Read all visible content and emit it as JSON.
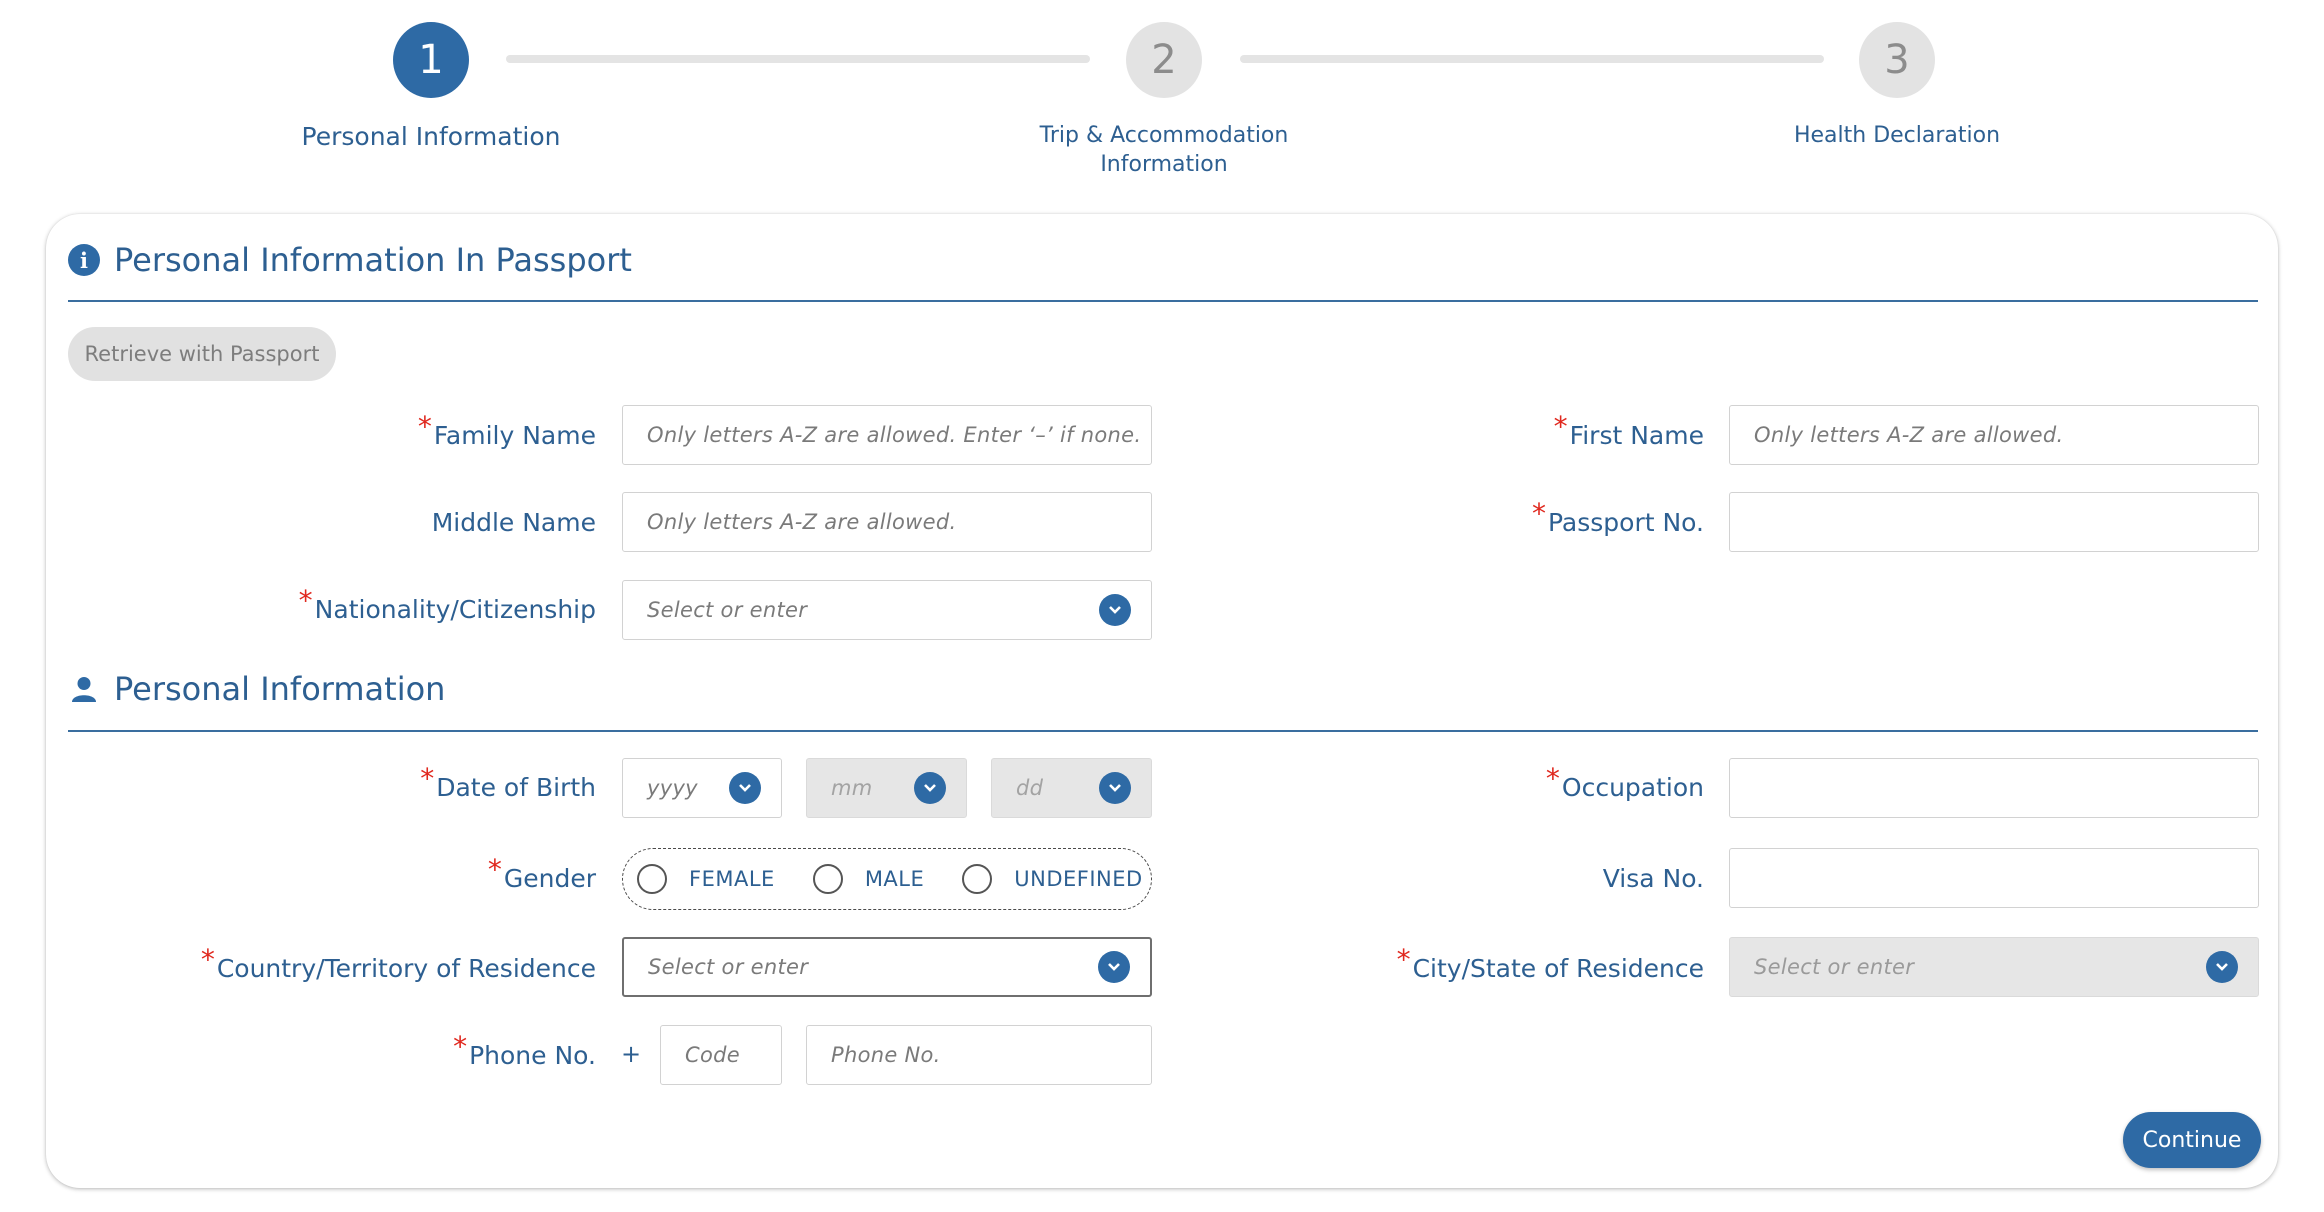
{
  "stepper": {
    "steps": [
      {
        "number": "1",
        "label": "Personal Information",
        "state": "active"
      },
      {
        "number": "2",
        "label_line1": "Trip & Accommodation",
        "label_line2": "Information",
        "state": "inactive"
      },
      {
        "number": "3",
        "label": "Health Declaration",
        "state": "inactive"
      }
    ]
  },
  "passport_section": {
    "icon": "info-icon",
    "title": "Personal Information In Passport",
    "retrieve_button": "Retrieve with Passport",
    "fields": {
      "family_name": {
        "label": "Family Name",
        "required": "*",
        "placeholder": "Only letters A-Z are allowed. Enter ‘–’ if none."
      },
      "first_name": {
        "label": "First Name",
        "required": "*",
        "placeholder": "Only letters A-Z are allowed."
      },
      "middle_name": {
        "label": "Middle Name",
        "placeholder": "Only letters A-Z are allowed."
      },
      "passport_no": {
        "label": "Passport No.",
        "required": "*",
        "placeholder": ""
      },
      "nationality": {
        "label": "Nationality/Citizenship",
        "required": "*",
        "placeholder": "Select or enter"
      }
    }
  },
  "personal_section": {
    "icon": "person-icon",
    "title": "Personal Information",
    "fields": {
      "dob": {
        "label": "Date of Birth",
        "required": "*",
        "year_placeholder": "yyyy",
        "month_placeholder": "mm",
        "day_placeholder": "dd"
      },
      "occupation": {
        "label": "Occupation",
        "required": "*",
        "placeholder": ""
      },
      "gender": {
        "label": "Gender",
        "required": "*",
        "options": [
          "FEMALE",
          "MALE",
          "UNDEFINED"
        ]
      },
      "visa_no": {
        "label": "Visa No.",
        "placeholder": ""
      },
      "country_residence": {
        "label": "Country/Territory of Residence",
        "required": "*",
        "placeholder": "Select or enter"
      },
      "city_residence": {
        "label": "City/State of Residence",
        "required": "*",
        "placeholder": "Select or enter"
      },
      "phone": {
        "label": "Phone No.",
        "required": "*",
        "prefix": "+",
        "code_placeholder": "Code",
        "number_placeholder": "Phone No."
      }
    }
  },
  "actions": {
    "continue": "Continue"
  },
  "colors": {
    "accent": "#2e6aa5",
    "text": "#2d5f91",
    "required": "#e0281e",
    "disabled_bg": "#e6e6e6"
  }
}
